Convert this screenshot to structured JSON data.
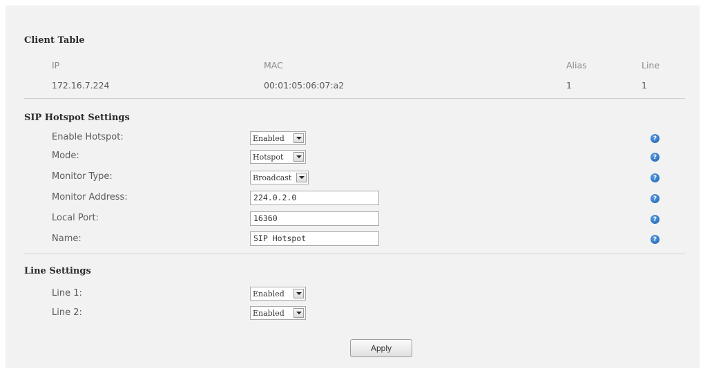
{
  "client_table": {
    "title": "Client Table",
    "columns": [
      "IP",
      "MAC",
      "Alias",
      "Line"
    ],
    "rows": [
      [
        "172.16.7.224",
        "00:01:05:06:07:a2",
        "1",
        "1"
      ]
    ]
  },
  "sip_hotspot": {
    "title": "SIP Hotspot Settings",
    "enable_hotspot": {
      "label": "Enable Hotspot:",
      "value": "Enabled"
    },
    "mode": {
      "label": "Mode:",
      "value": "Hotspot"
    },
    "monitor_type": {
      "label": "Monitor Type:",
      "value": "Broadcast"
    },
    "monitor_address": {
      "label": "Monitor Address:",
      "value": "224.0.2.0"
    },
    "local_port": {
      "label": "Local Port:",
      "value": "16360"
    },
    "name": {
      "label": "Name:",
      "value": "SIP Hotspot"
    },
    "help_glyph": "?"
  },
  "line_settings": {
    "title": "Line Settings",
    "line1": {
      "label": "Line 1:",
      "value": "Enabled"
    },
    "line2": {
      "label": "Line 2:",
      "value": "Enabled"
    }
  },
  "apply_label": "Apply",
  "colors": {
    "panel_bg": "#f2f2f2",
    "help_icon": "#1a5eab",
    "divider": "#cfcfcf"
  }
}
